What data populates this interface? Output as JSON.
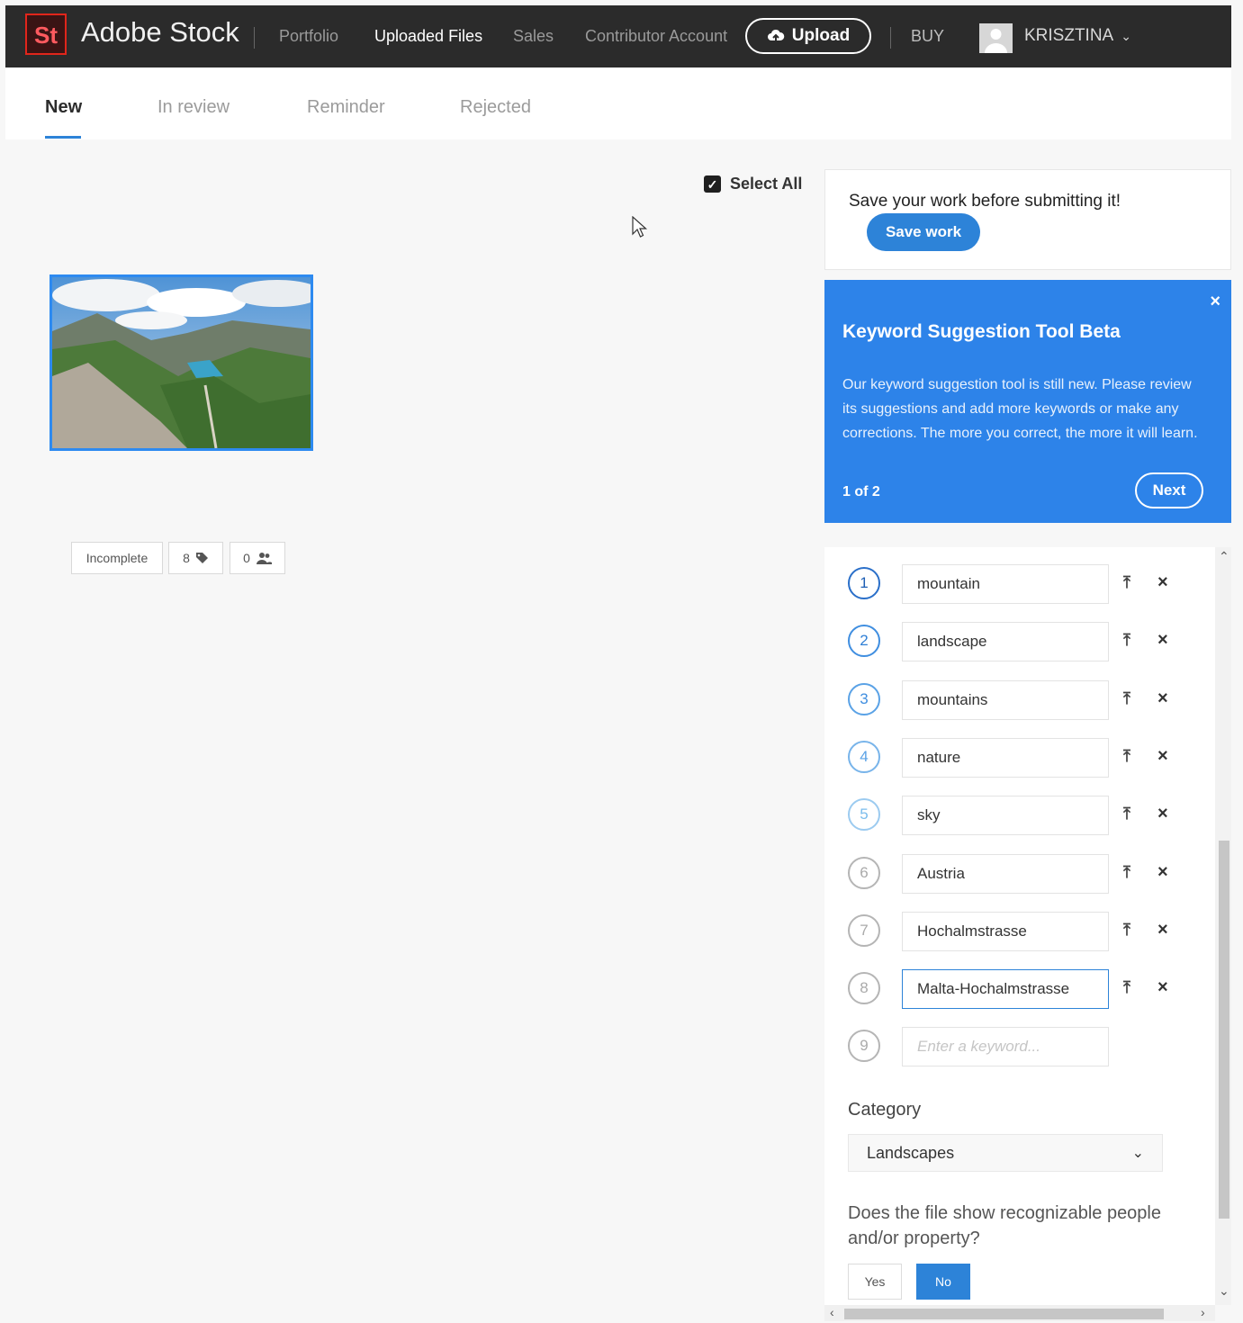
{
  "topbar": {
    "logo": "St",
    "brand": "Adobe Stock",
    "nav": [
      "Portfolio",
      "Uploaded Files",
      "Sales",
      "Contributor Account"
    ],
    "upload": "Upload",
    "buy": "BUY",
    "user": "KRISZTINA"
  },
  "tabs": [
    "New",
    "In review",
    "Reminder",
    "Rejected"
  ],
  "select_all": "Select All",
  "badges": {
    "status": "Incomplete",
    "keywords_count": "8",
    "people_count": "0"
  },
  "save_card": {
    "text": "Save your work before submitting it!",
    "button": "Save work"
  },
  "kw_tool": {
    "title": "Keyword Suggestion Tool Beta",
    "body": "Our keyword suggestion tool is still new. Please review its suggestions and add more keywords or make any corrections. The more you correct, the more it will learn.",
    "page": "1 of 2",
    "next": "Next",
    "close": "×"
  },
  "keywords": [
    {
      "num": "1",
      "value": "mountain"
    },
    {
      "num": "2",
      "value": "landscape"
    },
    {
      "num": "3",
      "value": "mountains"
    },
    {
      "num": "4",
      "value": "nature"
    },
    {
      "num": "5",
      "value": "sky"
    },
    {
      "num": "6",
      "value": "Austria"
    },
    {
      "num": "7",
      "value": "Hochalmstrasse"
    },
    {
      "num": "8",
      "value": "Malta-Hochalmstrasse"
    },
    {
      "num": "9",
      "value": "",
      "placeholder": "Enter a keyword..."
    }
  ],
  "category": {
    "label": "Category",
    "value": "Landscapes"
  },
  "people_question": {
    "label": "Does the file show recognizable people and/or property?",
    "yes": "Yes",
    "no": "No"
  },
  "colors": {
    "accent": "#2d83d8",
    "topbar": "#2b2b2b",
    "tool_card": "#2d83e9"
  }
}
